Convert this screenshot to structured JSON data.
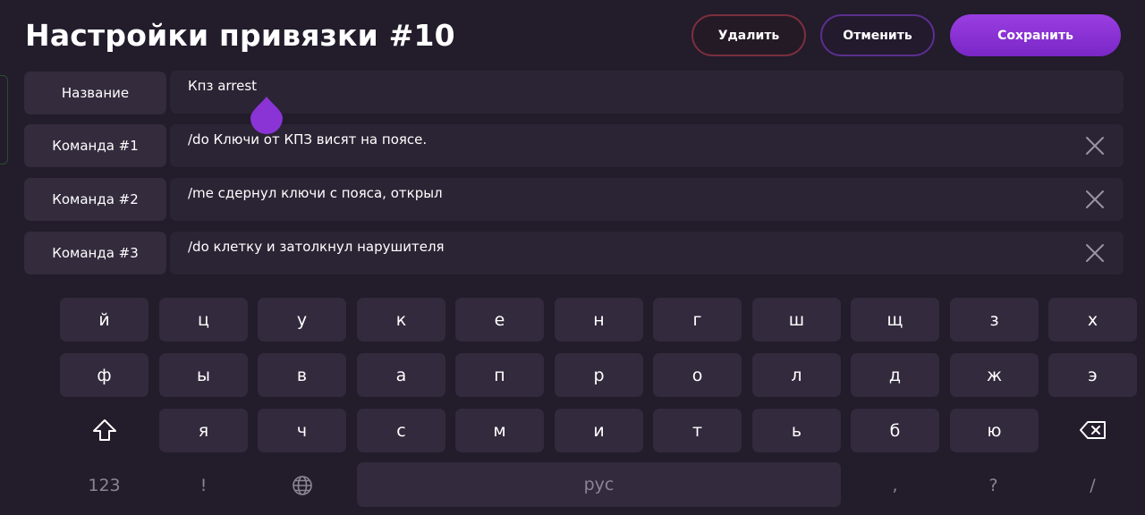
{
  "header": {
    "title": "Настройки привязки #10",
    "delete_label": "Удалить",
    "cancel_label": "Отменить",
    "save_label": "Сохранить"
  },
  "rows": [
    {
      "label": "Название",
      "value": "Кпз arrest"
    },
    {
      "label": "Команда #1",
      "value": "/do Ключи от КПЗ висят на поясе."
    },
    {
      "label": "Команда #2",
      "value": "/me сдернул ключи с пояса, открыл"
    },
    {
      "label": "Команда #3",
      "value": "/do клетку и затолкнул нарушителя"
    }
  ],
  "keyboard": {
    "row1": [
      "й",
      "ц",
      "у",
      "к",
      "е",
      "н",
      "г",
      "ш",
      "щ",
      "з",
      "х"
    ],
    "row2": [
      "ф",
      "ы",
      "в",
      "а",
      "п",
      "р",
      "о",
      "л",
      "д",
      "ж",
      "э"
    ],
    "row3": [
      "я",
      "ч",
      "с",
      "м",
      "и",
      "т",
      "ь",
      "б",
      "ю"
    ],
    "numbers_label": "123",
    "exclaim": "!",
    "space_label": "рус",
    "comma": ",",
    "question": "?",
    "slash": "/",
    "shift_icon": "shift-icon",
    "backspace_icon": "backspace-icon",
    "globe_icon": "globe-icon"
  },
  "colors": {
    "background": "#221c2b",
    "accent": "#8a34d6",
    "delete_border": "#7a2f3d",
    "cancel_border": "#5b2f8e"
  }
}
